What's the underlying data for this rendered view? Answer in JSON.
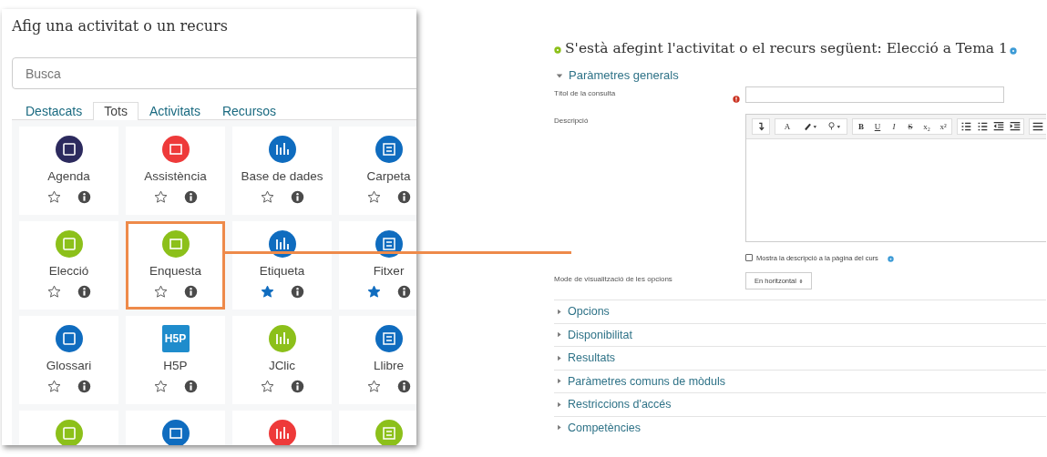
{
  "dialog": {
    "title": "Afig una activitat o un recurs",
    "search": {
      "placeholder": "Busca"
    },
    "tabs": [
      {
        "label": "Destacats",
        "selected": false
      },
      {
        "label": "Tots",
        "selected": true
      },
      {
        "label": "Activitats",
        "selected": false
      },
      {
        "label": "Recursos",
        "selected": false
      }
    ],
    "tiles": [
      {
        "label": "Agenda",
        "color": "#2c2a5e",
        "starred": false,
        "highlighted": false
      },
      {
        "label": "Assistència",
        "color": "#ee3a3a",
        "starred": false,
        "highlighted": false
      },
      {
        "label": "Base de dades",
        "color": "#0f6cbf",
        "starred": false,
        "highlighted": false
      },
      {
        "label": "Carpeta",
        "color": "#0f6cbf",
        "starred": false,
        "highlighted": false
      },
      {
        "label": "Elecció",
        "color": "#8cc01a",
        "starred": false,
        "highlighted": false
      },
      {
        "label": "Enquesta",
        "color": "#8cc01a",
        "starred": false,
        "highlighted": true
      },
      {
        "label": "Etiqueta",
        "color": "#0f6cbf",
        "starred": true,
        "highlighted": false
      },
      {
        "label": "Fitxer",
        "color": "#0f6cbf",
        "starred": true,
        "highlighted": false
      },
      {
        "label": "Glossari",
        "color": "#0f6cbf",
        "starred": false,
        "highlighted": false
      },
      {
        "label": "H5P",
        "color": "#1f8ccc",
        "icon_text": "H5P",
        "starred": false,
        "highlighted": false
      },
      {
        "label": "JClic",
        "color": "#8cc01a",
        "starred": false,
        "highlighted": false
      },
      {
        "label": "Llibre",
        "color": "#0f6cbf",
        "starred": false,
        "highlighted": false
      },
      {
        "color": "#8cc01a"
      },
      {
        "color": "#0f6cbf"
      },
      {
        "color": "#ee3a3a"
      },
      {
        "color": "#8cc01a"
      }
    ]
  },
  "form": {
    "heading": "S'està afegint l'activitat o el recurs següent: Elecció a Tema 1",
    "general": {
      "title": "Paràmetres generals",
      "expanded": true
    },
    "name_field": {
      "label": "Títol de la consulta",
      "required": true
    },
    "description": {
      "label": "Descripció",
      "toolbar": [
        [
          {
            "kind": "redo"
          }
        ],
        [
          {
            "kind": "menu",
            "label": "A"
          },
          {
            "kind": "brush"
          },
          {
            "kind": "bulb"
          }
        ],
        [
          {
            "kind": "bold",
            "label": "B"
          },
          {
            "kind": "underline",
            "label": "U"
          },
          {
            "kind": "italic",
            "label": "I"
          },
          {
            "kind": "strike",
            "label": "S"
          },
          {
            "kind": "text",
            "label": "x₂"
          },
          {
            "kind": "text",
            "label": "x²"
          }
        ],
        [
          {
            "kind": "bullets"
          },
          {
            "kind": "numbers"
          },
          {
            "kind": "outdent"
          },
          {
            "kind": "indent"
          }
        ],
        [
          {
            "kind": "align"
          }
        ]
      ]
    },
    "show_description": {
      "label": "Mostra la descripció a la pàgina del curs",
      "checked": false
    },
    "display_mode": {
      "label": "Mode de visualització de les opcions",
      "value": "En horitzontal"
    },
    "sections": [
      {
        "title": "Opcions",
        "expanded": false
      },
      {
        "title": "Disponibilitat",
        "expanded": false
      },
      {
        "title": "Resultats",
        "expanded": false
      },
      {
        "title": "Paràmetres comuns de mòduls",
        "expanded": false
      },
      {
        "title": "Restriccions d'accés",
        "expanded": false
      },
      {
        "title": "Competències",
        "expanded": false
      }
    ]
  }
}
